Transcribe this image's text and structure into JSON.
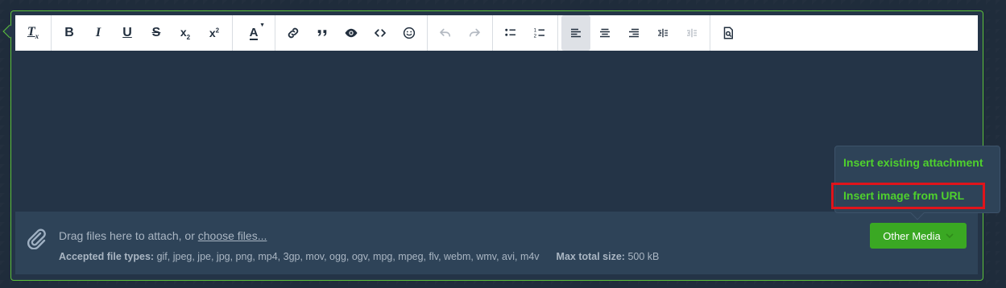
{
  "toolbar": {
    "groups": [
      [
        {
          "name": "clear-formatting",
          "label": "Tx"
        }
      ],
      [
        {
          "name": "bold",
          "label": "B"
        },
        {
          "name": "italic",
          "label": "I"
        },
        {
          "name": "underline",
          "label": "U"
        },
        {
          "name": "strikethrough",
          "label": "S"
        },
        {
          "name": "subscript",
          "label": "x₂"
        },
        {
          "name": "superscript",
          "label": "x²"
        }
      ],
      [
        {
          "name": "text-color",
          "label": "A"
        }
      ],
      [
        {
          "name": "link"
        },
        {
          "name": "blockquote"
        },
        {
          "name": "spoiler"
        },
        {
          "name": "code"
        },
        {
          "name": "emoji"
        }
      ],
      [
        {
          "name": "undo"
        },
        {
          "name": "redo"
        }
      ],
      [
        {
          "name": "bullet-list"
        },
        {
          "name": "numbered-list"
        }
      ],
      [
        {
          "name": "align-left"
        },
        {
          "name": "align-center"
        },
        {
          "name": "align-right"
        },
        {
          "name": "indent"
        },
        {
          "name": "outdent"
        }
      ],
      [
        {
          "name": "preview"
        }
      ]
    ]
  },
  "attachments": {
    "drag_text": "Drag files here to attach, or ",
    "choose_link": "choose files...",
    "types_label": "Accepted file types:",
    "types_value": "gif, jpeg, jpe, jpg, png, mp4, 3gp, mov, ogg, ogv, mpg, mpeg, flv, webm, wmv, avi, m4v",
    "max_label": "Max total size:",
    "max_value": "500 kB"
  },
  "media_button": {
    "label": "Other Media"
  },
  "popup": {
    "item1": "Insert existing attachment",
    "item2": "Insert image from URL"
  },
  "colors": {
    "accent_green": "#4fd12d",
    "button_green": "#3aa823",
    "highlight_red": "#e0141b"
  }
}
